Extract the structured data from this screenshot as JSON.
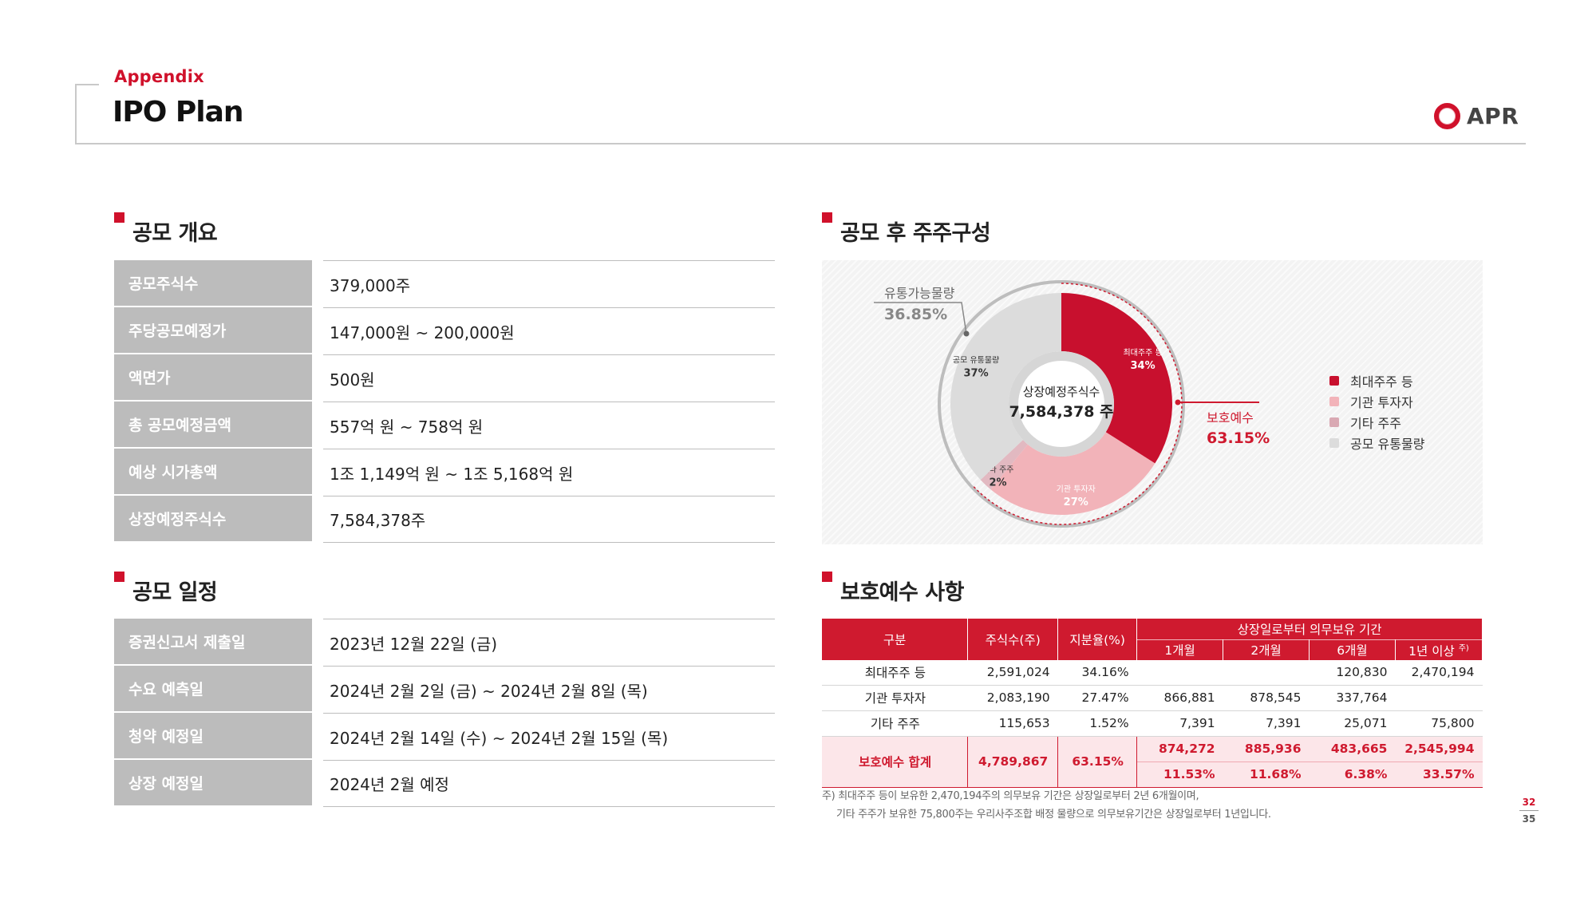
{
  "header": {
    "section_label": "Appendix",
    "title": "IPO Plan",
    "logo_text": "APR"
  },
  "offering_overview": {
    "title": "공모 개요",
    "rows": [
      {
        "label": "공모주식수",
        "value": "379,000주"
      },
      {
        "label": "주당공모예정가",
        "value": "147,000원 ~ 200,000원"
      },
      {
        "label": "액면가",
        "value": "500원"
      },
      {
        "label": "총 공모예정금액",
        "value": "557억 원 ~ 758억 원"
      },
      {
        "label": "예상 시가총액",
        "value": "1조 1,149억 원 ~ 1조 5,168억 원"
      },
      {
        "label": "상장예정주식수",
        "value": "7,584,378주"
      }
    ]
  },
  "offering_schedule": {
    "title": "공모 일정",
    "rows": [
      {
        "label": "증권신고서 제출일",
        "value": "2023년 12월 22일 (금)"
      },
      {
        "label": "수요 예측일",
        "value": "2024년 2월 2일 (금) ~ 2024년 2월 8일 (목)"
      },
      {
        "label": "청약 예정일",
        "value": "2024년 2월 14일 (수) ~ 2024년 2월 15일 (목)"
      },
      {
        "label": "상장 예정일",
        "value": "2024년 2월 예정"
      }
    ]
  },
  "shareholder_section": {
    "title": "공모 후 주주구성",
    "center_label": "상장예정주식수",
    "center_value": "7,584,378 주",
    "float_label": "유통가능물량",
    "float_value": "36.85%",
    "lockup_label": "보호예수",
    "lockup_value": "63.15%"
  },
  "chart_data": {
    "type": "pie",
    "categories": [
      "최대주주 등",
      "기관 투자자",
      "기타 주주",
      "공모 유통물량"
    ],
    "values": [
      34,
      27,
      2,
      37
    ],
    "data_labels": [
      "34%",
      "27%",
      "2%",
      "37%"
    ],
    "colors": [
      "#c8102e",
      "#f2b3b9",
      "#e2b9c1",
      "#dcdcdc"
    ],
    "legend_position": "right"
  },
  "lockup_section": {
    "title": "보호예수 사항",
    "headers": {
      "category": "구분",
      "shares": "주식수(주)",
      "ratio": "지분율(%)",
      "period_group": "상장일로부터 의무보유 기간",
      "m1": "1개월",
      "m2": "2개월",
      "m6": "6개월",
      "y1": "1년 이상",
      "y1_note": "주)"
    },
    "rows": [
      {
        "category": "최대주주 등",
        "shares": "2,591,024",
        "ratio": "34.16%",
        "m1": "",
        "m2": "",
        "m6": "120,830",
        "y1": "2,470,194"
      },
      {
        "category": "기관 투자자",
        "shares": "2,083,190",
        "ratio": "27.47%",
        "m1": "866,881",
        "m2": "878,545",
        "m6": "337,764",
        "y1": ""
      },
      {
        "category": "기타 주주",
        "shares": "115,653",
        "ratio": "1.52%",
        "m1": "7,391",
        "m2": "7,391",
        "m6": "25,071",
        "y1": "75,800"
      }
    ],
    "total": {
      "category": "보호예수 합계",
      "shares": "4,789,867",
      "ratio": "63.15%",
      "m1": "874,272",
      "m2": "885,936",
      "m6": "483,665",
      "y1": "2,545,994",
      "m1_pct": "11.53%",
      "m2_pct": "11.68%",
      "m6_pct": "6.38%",
      "y1_pct": "33.57%"
    },
    "note_line1": "주) 최대주주 등이 보유한 2,470,194주의 의무보유 기간은 상장일로부터 2년 6개월이며,",
    "note_line2": "기타 주주가 보유한 75,800주는 우리사주조합 배정 물량으로 의무보유기간은 상장일로부터 1년입니다."
  },
  "pager": {
    "current": "32",
    "total": "35"
  }
}
